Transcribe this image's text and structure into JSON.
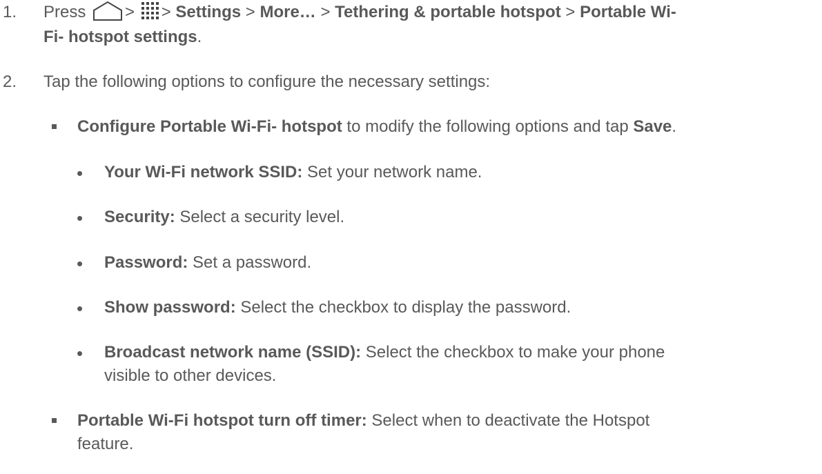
{
  "steps": [
    {
      "number": "1.",
      "press": "Press",
      "sep": ">",
      "path": [
        "Settings",
        "More…",
        "Tethering & portable hotspot",
        "Portable Wi-",
        "Fi- hotspot settings"
      ],
      "end": "."
    },
    {
      "number": "2.",
      "text": "Tap the following options to configure the necessary settings:"
    }
  ],
  "configure": {
    "bold": "Configure Portable Wi-Fi- hotspot",
    "text": " to modify the following options and tap ",
    "save": "Save",
    "end": ".",
    "options": [
      {
        "bold": "Your Wi-Fi network SSID:",
        "text": " Set your network name."
      },
      {
        "bold": "Security:",
        "text": " Select a security level."
      },
      {
        "bold": "Password:",
        "text": " Set a password."
      },
      {
        "bold": "Show password:",
        "text": " Select the checkbox to display the password."
      },
      {
        "bold": "Broadcast network name (SSID):",
        "text": " Select the checkbox to make your phone",
        "cont": "visible to other devices."
      }
    ]
  },
  "timer": {
    "bold": "Portable Wi-Fi hotspot turn off timer:",
    "text": " Select when to deactivate the Hotspot",
    "cont": "feature."
  },
  "icons": {
    "home": "home-icon",
    "apps": "apps-grid-icon"
  }
}
